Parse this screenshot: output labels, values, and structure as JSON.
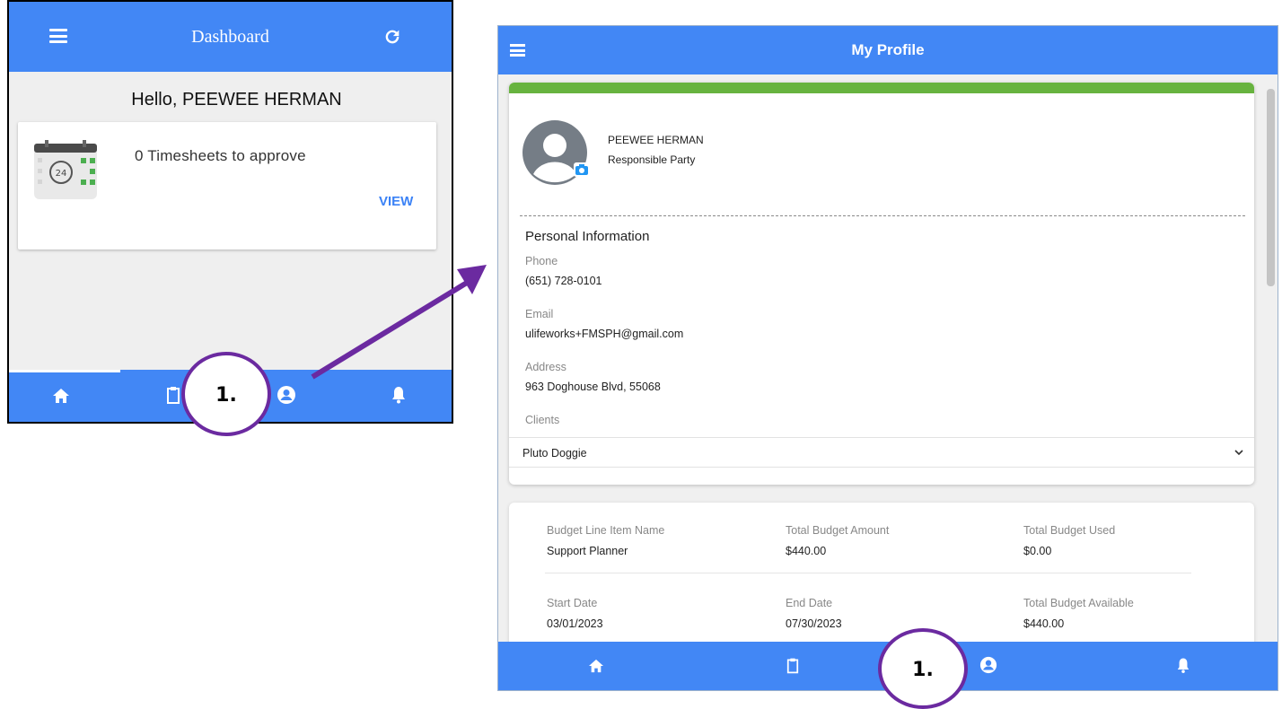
{
  "dashboard": {
    "title": "Dashboard",
    "greeting": "Hello, PEEWEE HERMAN",
    "card": {
      "text": "0 Timesheets to approve",
      "action": "VIEW",
      "calendar_day": "24"
    },
    "bottom_nav": [
      "home-icon",
      "clipboard-icon",
      "account-icon",
      "bell-icon"
    ]
  },
  "profile": {
    "title": "My Profile",
    "name": "PEEWEE HERMAN",
    "role": "Responsible Party",
    "section_title": "Personal Information",
    "phone_label": "Phone",
    "phone": "(651) 728-0101",
    "email_label": "Email",
    "email": "ulifeworks+FMSPH@gmail.com",
    "address_label": "Address",
    "address": "963 Doghouse Blvd, 55068",
    "clients_label": "Clients",
    "clients_selected": "Pluto Doggie",
    "budget": {
      "line_item_label": "Budget Line Item Name",
      "line_item": "Support Planner",
      "total_amount_label": "Total Budget Amount",
      "total_amount": "$440.00",
      "total_used_label": "Total Budget Used",
      "total_used": "$0.00",
      "start_label": "Start Date",
      "start": "03/01/2023",
      "end_label": "End Date",
      "end": "07/30/2023",
      "available_label": "Total Budget Available",
      "available": "$440.00"
    },
    "bottom_nav": [
      "home-icon",
      "clipboard-icon",
      "account-icon",
      "bell-icon"
    ]
  },
  "annotations": {
    "step_label": "1.",
    "colors": {
      "annotation": "#6b2aa0",
      "brand": "#4287f5",
      "accent_green": "#67b33f"
    }
  }
}
